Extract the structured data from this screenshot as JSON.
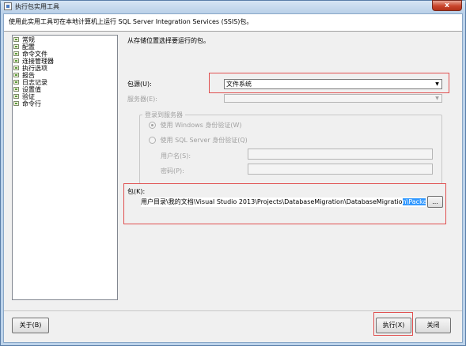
{
  "window": {
    "title": "执行包实用工具",
    "close_glyph": "x"
  },
  "header": {
    "text": "使用此实用工具可在本地计算机上运行 SQL Server Integration Services (SSIS)包。"
  },
  "sidebar": {
    "items": [
      {
        "label": "常规"
      },
      {
        "label": "配置"
      },
      {
        "label": "命令文件"
      },
      {
        "label": "连接管理器"
      },
      {
        "label": "执行选项"
      },
      {
        "label": "报告"
      },
      {
        "label": "日志记录"
      },
      {
        "label": "设置值"
      },
      {
        "label": "验证"
      },
      {
        "label": "命令行"
      }
    ]
  },
  "main": {
    "instruction": "从存储位置选择要运行的包。",
    "package_source": {
      "label": "包源(U):",
      "value": "文件系统",
      "arrow": "▼"
    },
    "server": {
      "label": "服务器(E):",
      "value": "",
      "arrow": "▼"
    },
    "login": {
      "group_label": "登录到服务器",
      "windows_auth_label": "使用 Windows 身份验证(W)",
      "sql_auth_label": "使用 SQL Server 身份验证(Q)",
      "username_label": "用户名(S):",
      "password_label": "密码(P):"
    },
    "package": {
      "label": "包(K):",
      "path_plain": "用户目录\\我的文档\\Visual Studio 2013\\Projects\\DatabaseMigration\\DatabaseMigratio",
      "path_selected": "n\\Package.dtsx",
      "browse_label": "..."
    }
  },
  "footer": {
    "about_label": "关于(B)",
    "execute_label": "执行(X)",
    "close_label": "关闭"
  },
  "colors": {
    "highlight_red": "#e05050",
    "selection_blue": "#3399ff"
  }
}
